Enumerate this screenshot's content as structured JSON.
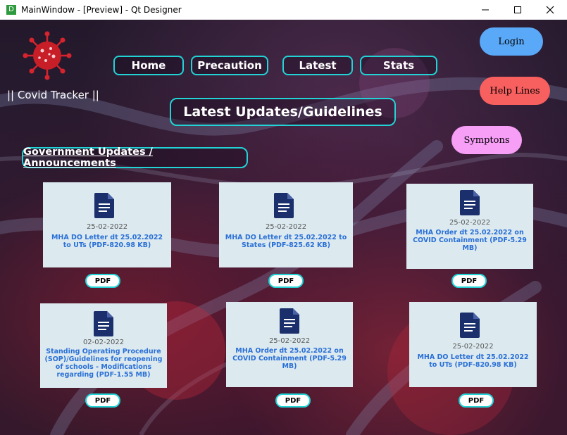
{
  "window": {
    "title": "MainWindow - [Preview] - Qt Designer",
    "app_icon_letter": "D"
  },
  "brand": {
    "name": "|| Covid Tracker ||"
  },
  "nav": [
    {
      "label": "Home"
    },
    {
      "label": "Precaution"
    },
    {
      "label": "Latest"
    },
    {
      "label": "Stats"
    }
  ],
  "side_buttons": {
    "login": "Login",
    "helplines": "Help Lines",
    "symptoms": "Symptons"
  },
  "colors": {
    "accent": "#22d3d6",
    "login": "#5aa9f8",
    "helplines": "#f85f5f",
    "symptoms": "#f79ef7",
    "card_bg": "#dceaf0",
    "doc_icon": "#1a2f6b",
    "card_title": "#2a6fd6"
  },
  "heading": "Latest Updates/Guidelines",
  "section": "Government Updates / Announcements",
  "cards": [
    {
      "date": "25-02-2022",
      "title": "MHA DO Letter dt 25.02.2022 to UTs (PDF-820.98 KB)",
      "button": "PDF"
    },
    {
      "date": "25-02-2022",
      "title": "MHA DO Letter dt 25.02.2022 to States (PDF-825.62 KB)",
      "button": "PDF"
    },
    {
      "date": "25-02-2022",
      "title": "MHA Order dt 25.02.2022 on COVID Containment (PDF-5.29 MB)",
      "button": "PDF"
    },
    {
      "date": "02-02-2022",
      "title": "Standing Operating Procedure (SOP)/Guidelines for reopening of schools - Modifications regarding (PDF-1.55 MB)",
      "button": "PDF"
    },
    {
      "date": "25-02-2022",
      "title": "MHA Order dt 25.02.2022 on COVID Containment (PDF-5.29 MB)",
      "button": "PDF"
    },
    {
      "date": "25-02-2022",
      "title": "MHA DO Letter dt 25.02.2022 to UTs (PDF-820.98 KB)",
      "button": "PDF"
    }
  ]
}
